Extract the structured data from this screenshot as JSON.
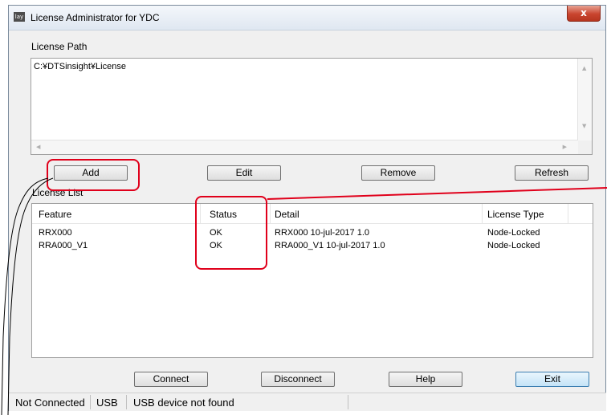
{
  "window": {
    "title": "License Administrator for YDC",
    "app_icon_text": "lay",
    "close_glyph": "x"
  },
  "license_path": {
    "label": "License Path",
    "value": "C:¥DTSinsight¥License"
  },
  "buttons": {
    "add": "Add",
    "edit": "Edit",
    "remove": "Remove",
    "refresh": "Refresh",
    "connect": "Connect",
    "disconnect": "Disconnect",
    "help": "Help",
    "exit": "Exit"
  },
  "license_list": {
    "label": "License List",
    "columns": [
      "Feature",
      "Status",
      "Detail",
      "License Type"
    ],
    "rows": [
      [
        "RRX000",
        "OK",
        "RRX000 10-jul-2017 1.0",
        "Node-Locked"
      ],
      [
        "RRA000_V1",
        "OK",
        "RRA000_V1 10-jul-2017 1.0",
        "Node-Locked"
      ]
    ]
  },
  "status_bar": {
    "connection": "Not Connected",
    "interface": "USB",
    "message": "USB device not found"
  },
  "annotation": {
    "highlight_color": "#e0001b"
  }
}
